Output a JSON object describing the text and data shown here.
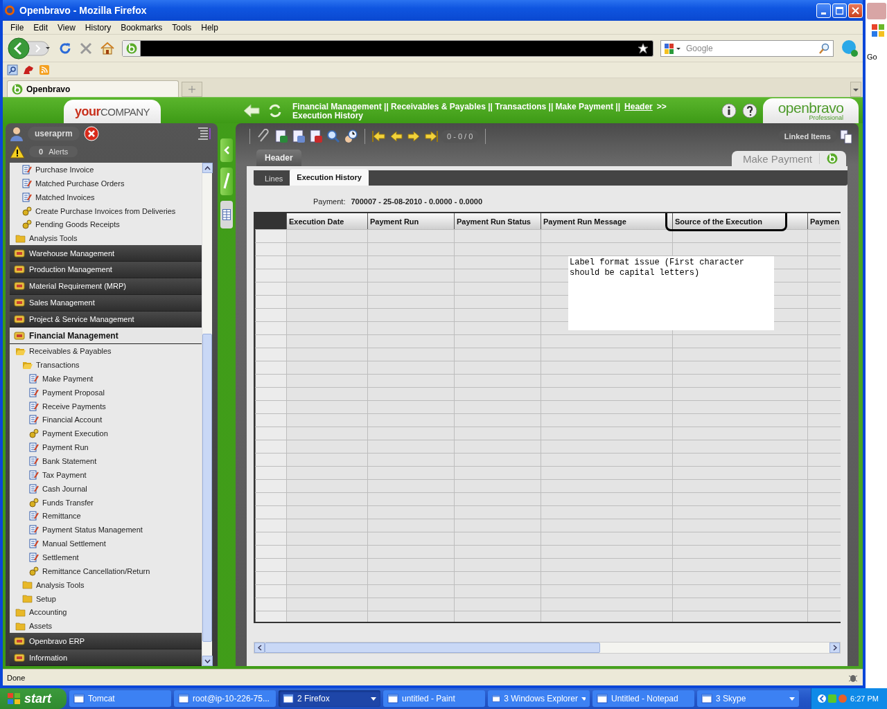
{
  "window": {
    "title": "Openbravo - Mozilla Firefox"
  },
  "menu_bar": [
    "File",
    "Edit",
    "View",
    "History",
    "Bookmarks",
    "Tools",
    "Help"
  ],
  "search": {
    "placeholder": "Google"
  },
  "browser_tabs": [
    {
      "label": "Openbravo",
      "selected": true
    }
  ],
  "app": {
    "company": {
      "your": "your",
      "name": "COMPANY"
    },
    "breadcrumb": {
      "path": "Financial Management || Receivables & Payables || Transactions || Make Payment ||",
      "link": "Header",
      "more": ">>",
      "current": "Execution History"
    },
    "logo": {
      "name": "openbravo",
      "edition": "Professional"
    },
    "user": {
      "name": "useraprm",
      "alerts_count": "0",
      "alerts_label": "Alerts"
    },
    "menu": [
      {
        "children": [
          {
            "children": [
              {
                "kind": "window",
                "label": "Purchase Invoice"
              },
              {
                "kind": "window",
                "label": "Matched Purchase Orders"
              },
              {
                "kind": "window",
                "label": "Matched Invoices"
              },
              {
                "kind": "process",
                "label": "Create Purchase Invoices from Deliveries"
              },
              {
                "kind": "process",
                "label": "Pending Goods Receipts"
              }
            ]
          },
          {
            "kind": "folder",
            "label": "Analysis Tools",
            "expanded": false
          }
        ]
      },
      {
        "kind": "section",
        "label": "Warehouse Management",
        "selected": false
      },
      {
        "kind": "section",
        "label": "Production Management",
        "selected": false
      },
      {
        "kind": "section",
        "label": "Material Requirement (MRP)",
        "selected": false
      },
      {
        "kind": "section",
        "label": "Sales Management",
        "selected": false
      },
      {
        "kind": "section",
        "label": "Project & Service Management",
        "selected": false
      },
      {
        "kind": "section",
        "label": "Financial Management",
        "selected": true,
        "children": [
          {
            "kind": "folder",
            "label": "Receivables & Payables",
            "expanded": true,
            "children": [
              {
                "kind": "folder",
                "label": "Transactions",
                "expanded": true,
                "children": [
                  {
                    "kind": "window",
                    "label": "Make Payment"
                  },
                  {
                    "kind": "window",
                    "label": "Payment Proposal"
                  },
                  {
                    "kind": "window",
                    "label": "Receive Payments"
                  },
                  {
                    "kind": "window",
                    "label": "Financial Account"
                  },
                  {
                    "kind": "process",
                    "label": "Payment Execution"
                  },
                  {
                    "kind": "window",
                    "label": "Payment Run"
                  },
                  {
                    "kind": "window",
                    "label": "Bank Statement"
                  },
                  {
                    "kind": "window",
                    "label": "Tax Payment"
                  },
                  {
                    "kind": "window",
                    "label": "Cash Journal"
                  },
                  {
                    "kind": "process",
                    "label": "Funds Transfer"
                  },
                  {
                    "kind": "window",
                    "label": "Remittance"
                  },
                  {
                    "kind": "window",
                    "label": "Payment Status Management"
                  },
                  {
                    "kind": "window",
                    "label": "Manual Settlement"
                  },
                  {
                    "kind": "window",
                    "label": "Settlement"
                  },
                  {
                    "kind": "process",
                    "label": "Remittance Cancellation/Return"
                  }
                ]
              },
              {
                "kind": "folder",
                "label": "Analysis Tools",
                "expanded": false
              },
              {
                "kind": "folder",
                "label": "Setup",
                "expanded": false
              }
            ]
          },
          {
            "kind": "folder",
            "label": "Accounting",
            "expanded": false
          },
          {
            "kind": "folder",
            "label": "Assets",
            "expanded": false
          }
        ]
      },
      {
        "kind": "section",
        "label": "Openbravo ERP",
        "selected": false
      },
      {
        "kind": "section",
        "label": "Information",
        "selected": false
      }
    ],
    "record_counter": "0 - 0 / 0",
    "linked_items": "Linked Items",
    "window_name": "Make Payment",
    "header_tab": "Header",
    "tabs": [
      {
        "label": "Lines",
        "selected": false
      },
      {
        "label": "Execution History",
        "selected": true
      }
    ],
    "payment": {
      "label": "Payment:",
      "value": "700007 - 25-08-2010 - 0.0000 - 0.0000"
    },
    "table": {
      "columns": [
        "Execution Date",
        "Payment Run",
        "Payment Run Status",
        "Payment Run Message",
        "Source of the Execution",
        "Paymen"
      ]
    },
    "note": {
      "text": "Label format issue (First character should be capital letters)"
    }
  },
  "status_bar": "Done",
  "background_window": {
    "text": "Go"
  },
  "taskbar": {
    "start": "start",
    "items": [
      {
        "label": "Tomcat",
        "selected": false,
        "grouped": false
      },
      {
        "label": "root@ip-10-226-75...",
        "selected": false,
        "grouped": false
      },
      {
        "label": "2 Firefox",
        "selected": true,
        "grouped": true
      },
      {
        "label": "untitled - Paint",
        "selected": false,
        "grouped": false
      },
      {
        "label": "3 Windows Explorer",
        "selected": false,
        "grouped": true
      },
      {
        "label": "Untitled - Notepad",
        "selected": false,
        "grouped": false
      },
      {
        "label": "3 Skype",
        "selected": false,
        "grouped": true
      }
    ],
    "time": "6:27 PM"
  }
}
